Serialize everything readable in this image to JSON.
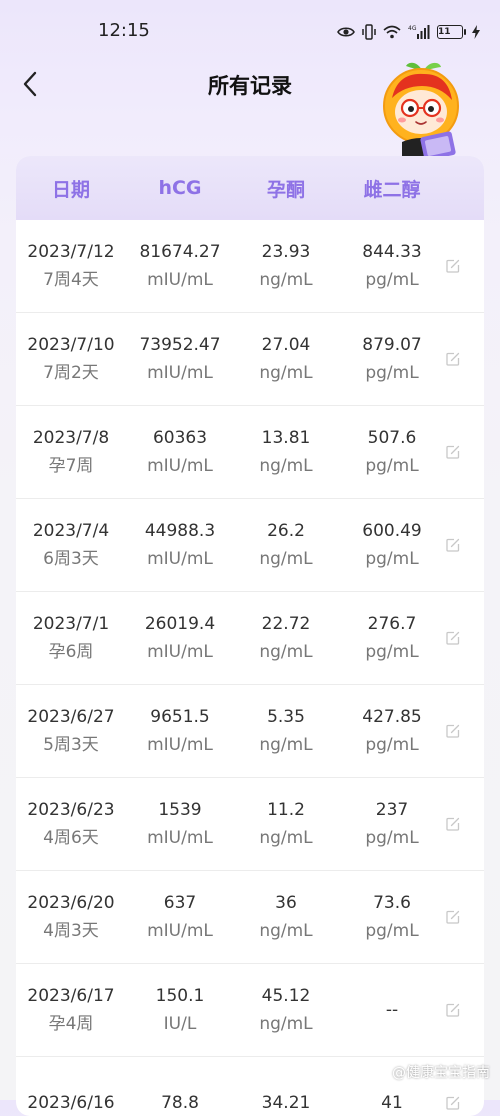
{
  "status_bar": {
    "time": "12:15",
    "network": "4G",
    "battery": "11",
    "icons": [
      "eye-icon",
      "vibrate-icon",
      "wifi-icon",
      "signal-icon",
      "battery-icon",
      "charging-icon"
    ]
  },
  "header": {
    "title": "所有记录",
    "back_icon": "chevron-left-icon"
  },
  "colors": {
    "accent": "#8e72e6",
    "header_bg": "#e4dcf8",
    "text": "#333333",
    "subtext": "#777777"
  },
  "table": {
    "columns": [
      "日期",
      "hCG",
      "孕酮",
      "雌二醇"
    ],
    "rows": [
      {
        "date": "2023/7/12",
        "week": "7周4天",
        "hcg": "81674.27",
        "hcg_unit": "mIU/mL",
        "prog": "23.93",
        "prog_unit": "ng/mL",
        "e2": "844.33",
        "e2_unit": "pg/mL"
      },
      {
        "date": "2023/7/10",
        "week": "7周2天",
        "hcg": "73952.47",
        "hcg_unit": "mIU/mL",
        "prog": "27.04",
        "prog_unit": "ng/mL",
        "e2": "879.07",
        "e2_unit": "pg/mL"
      },
      {
        "date": "2023/7/8",
        "week": "孕7周",
        "hcg": "60363",
        "hcg_unit": "mIU/mL",
        "prog": "13.81",
        "prog_unit": "ng/mL",
        "e2": "507.6",
        "e2_unit": "pg/mL"
      },
      {
        "date": "2023/7/4",
        "week": "6周3天",
        "hcg": "44988.3",
        "hcg_unit": "mIU/mL",
        "prog": "26.2",
        "prog_unit": "ng/mL",
        "e2": "600.49",
        "e2_unit": "pg/mL"
      },
      {
        "date": "2023/7/1",
        "week": "孕6周",
        "hcg": "26019.4",
        "hcg_unit": "mIU/mL",
        "prog": "22.72",
        "prog_unit": "ng/mL",
        "e2": "276.7",
        "e2_unit": "pg/mL"
      },
      {
        "date": "2023/6/27",
        "week": "5周3天",
        "hcg": "9651.5",
        "hcg_unit": "mIU/mL",
        "prog": "5.35",
        "prog_unit": "ng/mL",
        "e2": "427.85",
        "e2_unit": "pg/mL"
      },
      {
        "date": "2023/6/23",
        "week": "4周6天",
        "hcg": "1539",
        "hcg_unit": "mIU/mL",
        "prog": "11.2",
        "prog_unit": "ng/mL",
        "e2": "237",
        "e2_unit": "pg/mL"
      },
      {
        "date": "2023/6/20",
        "week": "4周3天",
        "hcg": "637",
        "hcg_unit": "mIU/mL",
        "prog": "36",
        "prog_unit": "ng/mL",
        "e2": "73.6",
        "e2_unit": "pg/mL"
      },
      {
        "date": "2023/6/17",
        "week": "孕4周",
        "hcg": "150.1",
        "hcg_unit": "IU/L",
        "prog": "45.12",
        "prog_unit": "ng/mL",
        "e2": "--",
        "e2_unit": ""
      },
      {
        "date": "2023/6/16",
        "week": "",
        "hcg": "78.8",
        "hcg_unit": "",
        "prog": "34.21",
        "prog_unit": "",
        "e2": "41",
        "e2_unit": ""
      }
    ]
  },
  "watermark": "@健康宝宝指南"
}
